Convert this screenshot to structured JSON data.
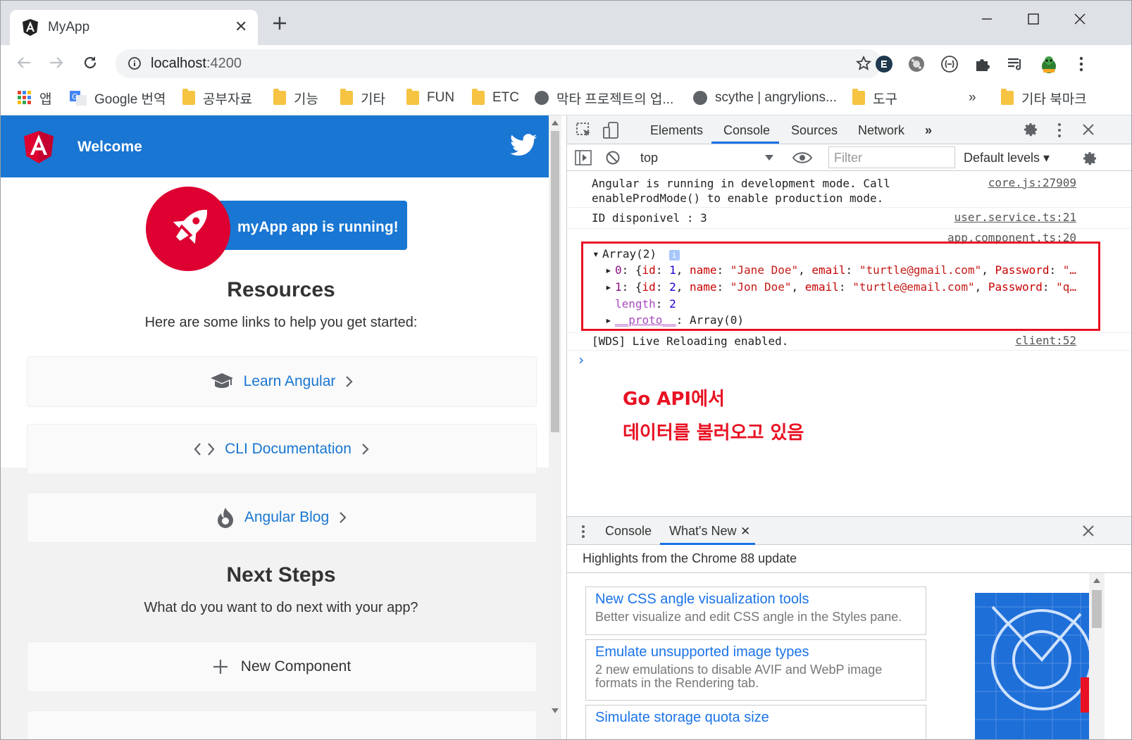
{
  "browser": {
    "tab_title": "MyApp",
    "url_host": "localhost",
    "url_port": ":4200"
  },
  "bookmarks": [
    {
      "label": "앱",
      "icon": "apps-grid-icon"
    },
    {
      "label": "Google 번역",
      "icon": "google-translate-icon"
    },
    {
      "label": "공부자료",
      "icon": "folder-icon"
    },
    {
      "label": "기능",
      "icon": "folder-icon"
    },
    {
      "label": "기타",
      "icon": "folder-icon"
    },
    {
      "label": "FUN",
      "icon": "folder-icon"
    },
    {
      "label": "ETC",
      "icon": "folder-icon"
    },
    {
      "label": "막타 프로젝트의 업...",
      "icon": "globe-icon"
    },
    {
      "label": "scythe | angrylions...",
      "icon": "globe-icon"
    },
    {
      "label": "도구",
      "icon": "folder-icon"
    },
    {
      "label": "»",
      "icon": ""
    },
    {
      "label": "기타 북마크",
      "icon": "folder-icon"
    }
  ],
  "app": {
    "header_title": "Welcome",
    "running_text": "myApp app is running!",
    "resources_title": "Resources",
    "resources_sub": "Here are some links to help you get started:",
    "cards": [
      {
        "label": "Learn Angular",
        "icon": "graduation-cap-icon"
      },
      {
        "label": "CLI Documentation",
        "icon": "code-brackets-icon"
      },
      {
        "label": "Angular Blog",
        "icon": "flame-icon"
      }
    ],
    "next_title": "Next Steps",
    "next_sub": "What do you want to do next with your app?",
    "new_component": "New Component"
  },
  "devtools": {
    "tabs": [
      "Elements",
      "Console",
      "Sources",
      "Network",
      "»"
    ],
    "context": "top",
    "filter_placeholder": "Filter",
    "levels": "Default levels ▾",
    "logs": {
      "angular_1": "Angular is running in development mode. Call",
      "angular_2": "enableProdMode() to enable production mode.",
      "angular_src": "core.js:27909",
      "id_text": "ID disponivel : 3",
      "id_src": "user.service.ts:21",
      "array_src": "app.component.ts:20",
      "array_head": "Array(2)",
      "row0_idx": "0",
      "row0_id": "1",
      "row0_name": "\"Jane Doe\"",
      "row0_email": "\"turtle@gmail.com\"",
      "row0_pass": "\"…",
      "row1_idx": "1",
      "row1_id": "2",
      "row1_name": "\"Jon Doe\"",
      "row1_email": "\"turtle@email.com\"",
      "row1_pass": "\"q…",
      "length_label": "length",
      "length_val": "2",
      "proto_label": "__proto__",
      "proto_val": "Array(0)",
      "wds_text": "[WDS] Live Reloading enabled.",
      "wds_src": "client:52",
      "prompt": "›"
    },
    "annotation_line1": "Go API에서",
    "annotation_line2": "데이터를 불러오고 있음",
    "drawer_tabs": [
      "Console",
      "What's New"
    ],
    "drawer_heading": "Highlights from the Chrome 88 update",
    "whats_new": [
      {
        "title": "New CSS angle visualization tools",
        "desc": "Better visualize and edit CSS angle in the Styles pane."
      },
      {
        "title": "Emulate unsupported image types",
        "desc": "2 new emulations to disable AVIF and WebP image formats in the Rendering tab."
      },
      {
        "title": "Simulate storage quota size",
        "desc": ""
      }
    ]
  }
}
